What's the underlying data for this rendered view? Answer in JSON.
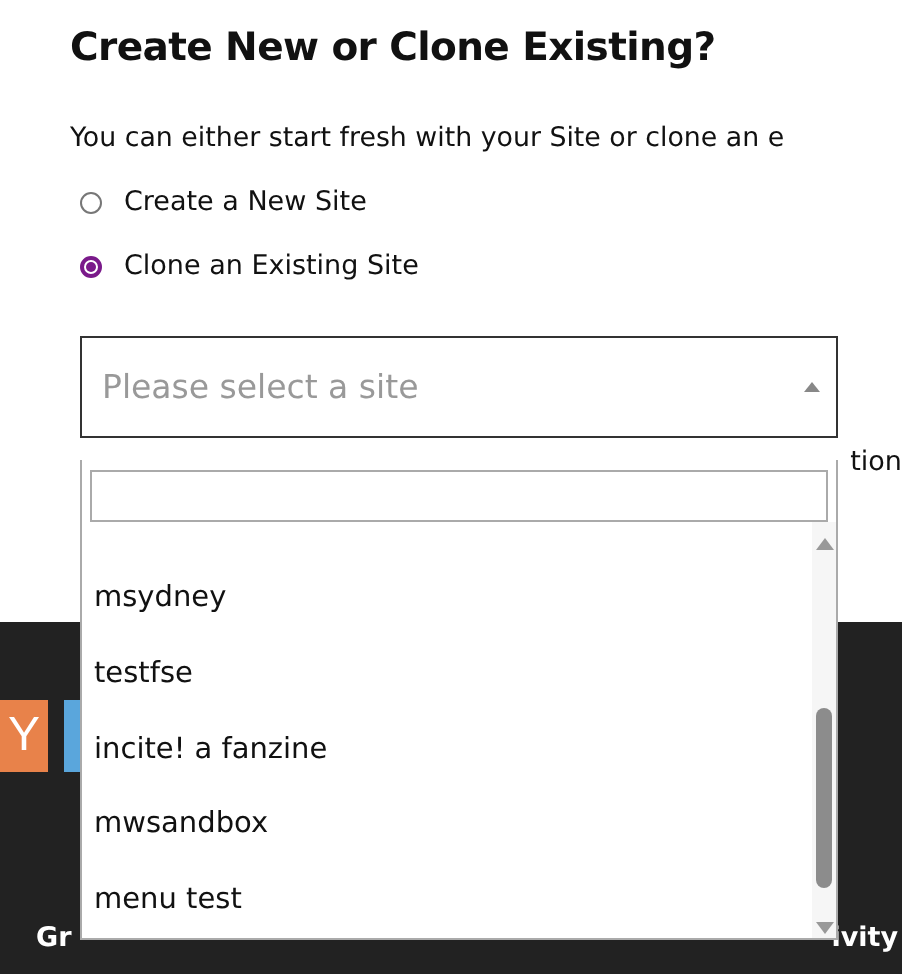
{
  "heading": "Create New or Clone Existing?",
  "intro": "You can either start fresh with your Site or clone an e",
  "options": [
    {
      "label": "Create a New Site",
      "selected": false
    },
    {
      "label": "Clone an Existing Site",
      "selected": true
    }
  ],
  "site_select": {
    "placeholder": "Please select a site",
    "expanded": true
  },
  "side_text": "tion",
  "dropdown": {
    "items": [
      "msydney",
      "testfse",
      "incite! a fanzine",
      "mwsandbox",
      "menu test"
    ]
  },
  "footer": {
    "logo": [
      "Y"
    ],
    "nav": [
      "Gr",
      "ivity"
    ]
  }
}
